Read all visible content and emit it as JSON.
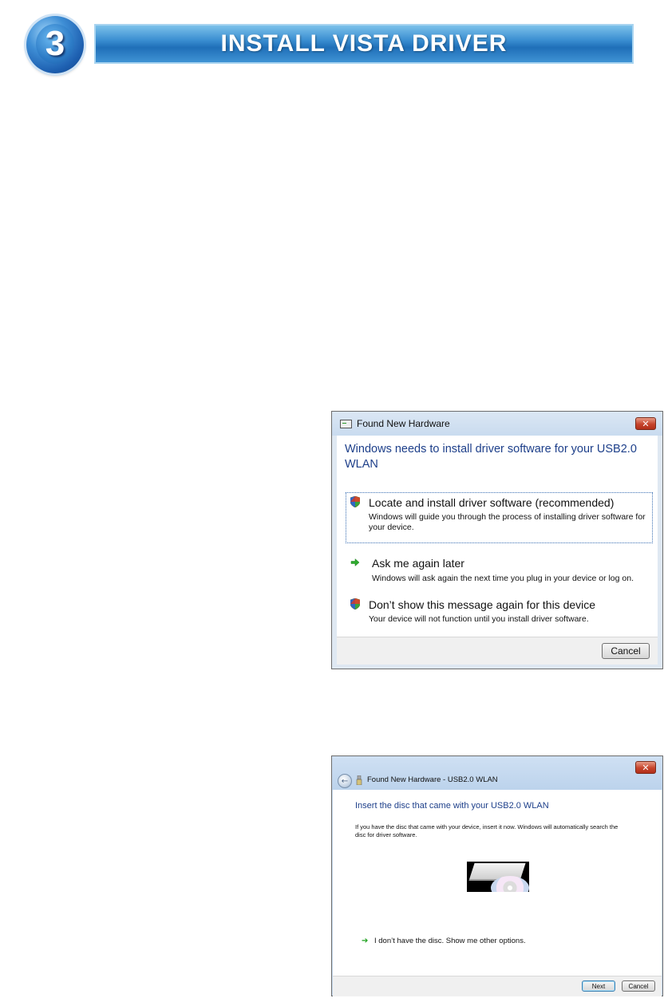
{
  "banner": {
    "step_number": "3",
    "title": "INSTALL VISTA DRIVER"
  },
  "dialog1": {
    "title": "Found New Hardware",
    "heading": "Windows needs to install driver software for your USB2.0 WLAN",
    "options": [
      {
        "title": "Locate and install driver software (recommended)",
        "description": "Windows will guide you through the process of installing driver software for your device.",
        "icon": "shield-icon"
      },
      {
        "title": "Ask me again later",
        "description": "Windows will ask again the next time you plug in your device or log on.",
        "icon": "green-arrow-icon"
      },
      {
        "title": "Don’t show this message again for this device",
        "description": "Your device will not function until you install driver software.",
        "icon": "shield-icon"
      }
    ],
    "cancel_label": "Cancel"
  },
  "dialog2": {
    "title": "Found New Hardware - USB2.0 WLAN",
    "heading": "Insert the disc that came with your USB2.0 WLAN",
    "body": "If you have the disc that came with your device, insert it now.  Windows will automatically search the disc for driver software.",
    "other_option": "I don’t have the disc.  Show me other options.",
    "next_label": "Next",
    "cancel_label": "Cancel"
  },
  "colors": {
    "heading_blue": "#1d3f8a",
    "close_red": "#c6442c",
    "arrow_green": "#1fa21f"
  }
}
